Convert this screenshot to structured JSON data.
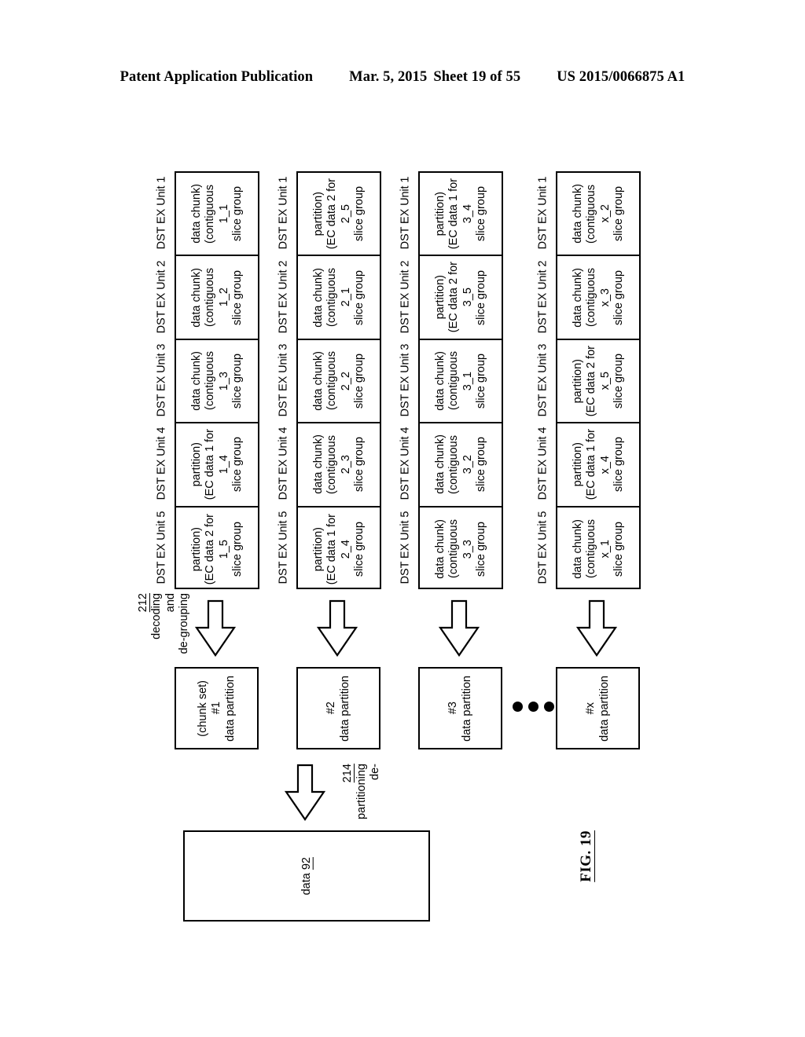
{
  "header": {
    "publication": "Patent Application Publication",
    "date": "Mar. 5, 2015",
    "sheet": "Sheet 19 of 55",
    "patent_number": "US 2015/0066875 A1"
  },
  "figure": {
    "label": "FIG. 19",
    "unit_labels": [
      "DST EX Unit 1",
      "DST EX Unit 2",
      "DST EX Unit 3",
      "DST EX Unit 4",
      "DST EX Unit 5"
    ],
    "degrouping_caption": {
      "line1": "de-grouping",
      "line2": "and",
      "line3": "decoding",
      "ref": "212"
    },
    "departitioning_caption": {
      "line1": "de-",
      "line2": "partitioning",
      "ref": "214"
    },
    "groups": [
      {
        "id": "group-1",
        "cells": [
          {
            "title": "slice group",
            "name": "1_1",
            "note1": "(contiguous",
            "note2": "data chunk)"
          },
          {
            "title": "slice group",
            "name": "1_2",
            "note1": "(contiguous",
            "note2": "data chunk)"
          },
          {
            "title": "slice group",
            "name": "1_3",
            "note1": "(contiguous",
            "note2": "data chunk)"
          },
          {
            "title": "slice group",
            "name": "1_4",
            "note1": "(EC data 1 for",
            "note2": "partition)"
          },
          {
            "title": "slice group",
            "name": "1_5",
            "note1": "(EC data 2 for",
            "note2": "partition)"
          }
        ]
      },
      {
        "id": "group-2",
        "cells": [
          {
            "title": "slice group",
            "name": "2_5",
            "note1": "(EC data 2 for",
            "note2": "partition)"
          },
          {
            "title": "slice group",
            "name": "2_1",
            "note1": "(contiguous",
            "note2": "data chunk)"
          },
          {
            "title": "slice group",
            "name": "2_2",
            "note1": "(contiguous",
            "note2": "data chunk)"
          },
          {
            "title": "slice group",
            "name": "2_3",
            "note1": "(contiguous",
            "note2": "data chunk)"
          },
          {
            "title": "slice group",
            "name": "2_4",
            "note1": "(EC data 1 for",
            "note2": "partition)"
          }
        ]
      },
      {
        "id": "group-3",
        "cells": [
          {
            "title": "slice group",
            "name": "3_4",
            "note1": "(EC data 1 for",
            "note2": "partition)"
          },
          {
            "title": "slice group",
            "name": "3_5",
            "note1": "(EC data 2 for",
            "note2": "partition)"
          },
          {
            "title": "slice group",
            "name": "3_1",
            "note1": "(contiguous",
            "note2": "data chunk)"
          },
          {
            "title": "slice group",
            "name": "3_2",
            "note1": "(contiguous",
            "note2": "data chunk)"
          },
          {
            "title": "slice group",
            "name": "3_3",
            "note1": "(contiguous",
            "note2": "data chunk)"
          }
        ]
      },
      {
        "id": "group-x",
        "cells": [
          {
            "title": "slice group",
            "name": "x_2",
            "note1": "(contiguous",
            "note2": "data chunk)"
          },
          {
            "title": "slice group",
            "name": "x_3",
            "note1": "(contiguous",
            "note2": "data chunk)"
          },
          {
            "title": "slice group",
            "name": "x_5",
            "note1": "(EC data 2 for",
            "note2": "partition)"
          },
          {
            "title": "slice group",
            "name": "x_4",
            "note1": "(EC data 1 for",
            "note2": "partition)"
          },
          {
            "title": "slice group",
            "name": "x_1",
            "note1": "(contiguous",
            "note2": "data chunk)"
          }
        ]
      }
    ],
    "partitions": [
      {
        "line1": "data partition",
        "line2": "#1",
        "line3": "(chunk set)"
      },
      {
        "line1": "data partition",
        "line2": "#2",
        "line3": ""
      },
      {
        "line1": "data partition",
        "line2": "#3",
        "line3": ""
      },
      {
        "line1": "data partition",
        "line2": "#x",
        "line3": ""
      }
    ],
    "data_box": {
      "label": "data",
      "ref": "92"
    }
  }
}
